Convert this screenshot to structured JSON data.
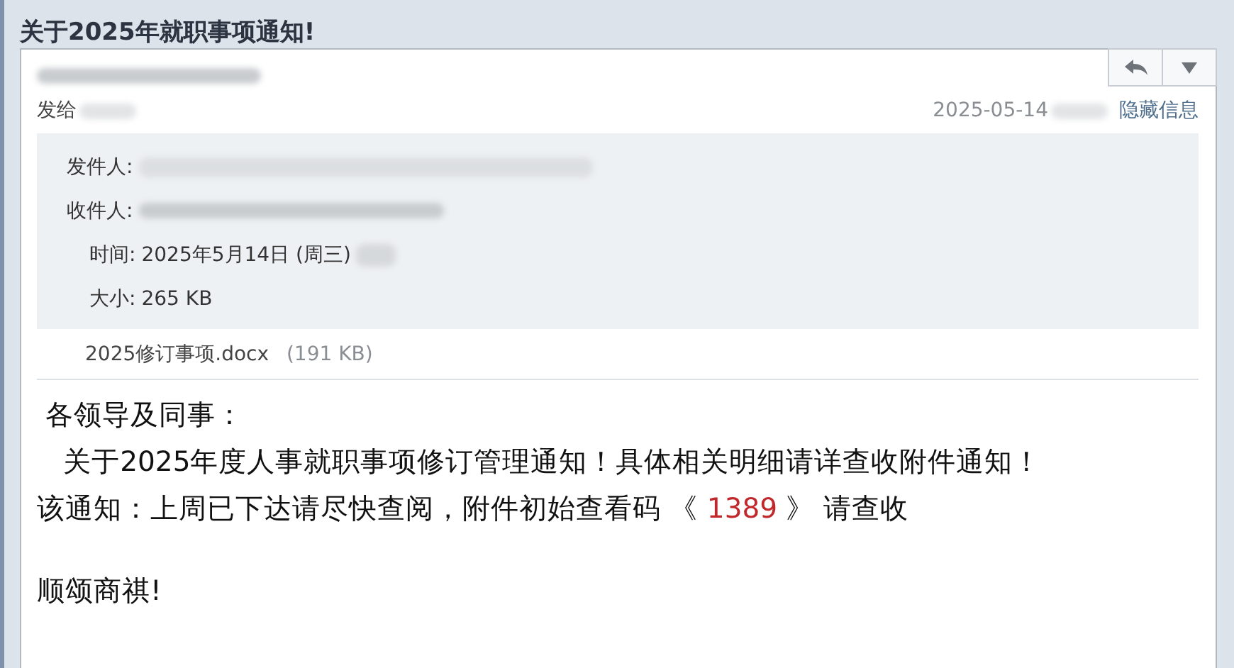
{
  "subject": "关于2025年就职事项通知!",
  "header": {
    "sent_to_label": "发给",
    "date": "2025-05-14",
    "toggle_link": "隐藏信息"
  },
  "details": [
    {
      "label": "发件人:"
    },
    {
      "label": "收件人:"
    },
    {
      "label": "时间:",
      "value": "2025年5月14日 (周三)"
    },
    {
      "label": "大小:",
      "value": "265 KB"
    }
  ],
  "attachment": {
    "name": "2025修订事项.docx",
    "size": "(191 KB)"
  },
  "body": [
    {
      "kind": "text",
      "segments": [
        {
          "kind": "plain",
          "text": " 各领导及同事："
        }
      ]
    },
    {
      "kind": "text",
      "segments": [
        {
          "kind": "plain",
          "text": "   关于2025年度人事就职事项修订管理通知！具体相关明细请详查收附件通知！"
        }
      ]
    },
    {
      "kind": "text",
      "segments": [
        {
          "kind": "plain",
          "text": "该通知：上周已下达请尽快查阅，附件初始查看码 《 "
        },
        {
          "kind": "code",
          "text": "1389"
        },
        {
          "kind": "plain",
          "text": " 》 请查收"
        }
      ]
    },
    {
      "kind": "gap"
    },
    {
      "kind": "text",
      "segments": [
        {
          "kind": "plain",
          "text": "顺颂商祺!"
        }
      ]
    }
  ]
}
